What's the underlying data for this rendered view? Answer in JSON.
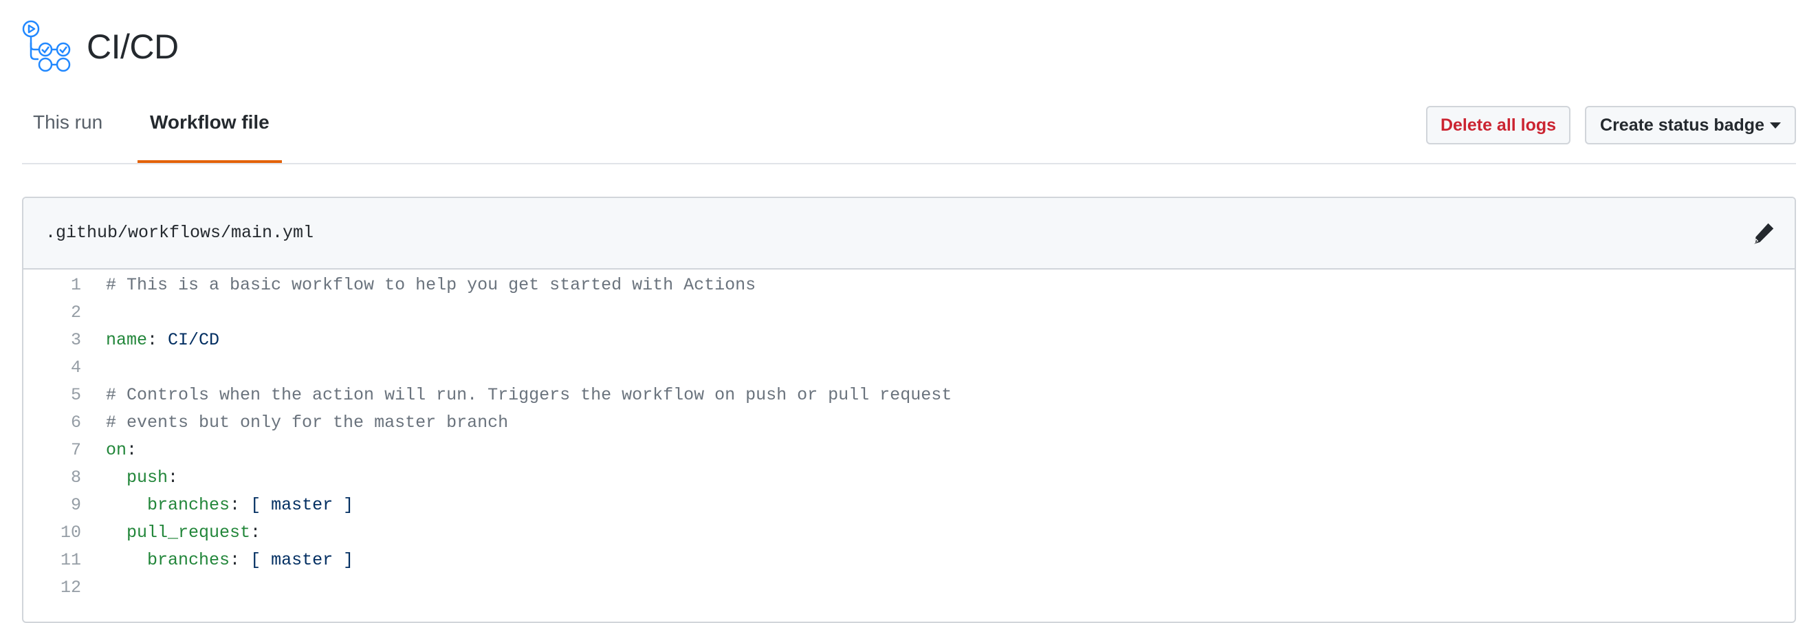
{
  "header": {
    "title": "CI/CD",
    "icon": "workflow-icon"
  },
  "tabs": [
    {
      "label": "This run",
      "active": false
    },
    {
      "label": "Workflow file",
      "active": true
    }
  ],
  "actions": {
    "delete_logs_label": "Delete all logs",
    "status_badge_label": "Create status badge"
  },
  "file": {
    "path": ".github/workflows/main.yml",
    "edit_icon": "pencil-icon",
    "lines": [
      {
        "n": "1",
        "comment": "# This is a basic workflow to help you get started with Actions"
      },
      {
        "n": "2"
      },
      {
        "n": "3",
        "key": "name",
        "value": "CI/CD"
      },
      {
        "n": "4"
      },
      {
        "n": "5",
        "comment": "# Controls when the action will run. Triggers the workflow on push or pull request"
      },
      {
        "n": "6",
        "comment": "# events but only for the master branch"
      },
      {
        "n": "7",
        "key": "on"
      },
      {
        "n": "8",
        "indent": "  ",
        "key": "push"
      },
      {
        "n": "9",
        "indent": "    ",
        "key": "branches",
        "value": "[ master ]"
      },
      {
        "n": "10",
        "indent": "  ",
        "key": "pull_request"
      },
      {
        "n": "11",
        "indent": "    ",
        "key": "branches",
        "value": "[ master ]"
      },
      {
        "n": "12"
      }
    ]
  },
  "colors": {
    "accent_tab": "#e36209",
    "danger": "#cb2431",
    "comment": "#6a737d",
    "key": "#22863a",
    "string": "#032f62",
    "icon_blue": "#2188ff"
  }
}
